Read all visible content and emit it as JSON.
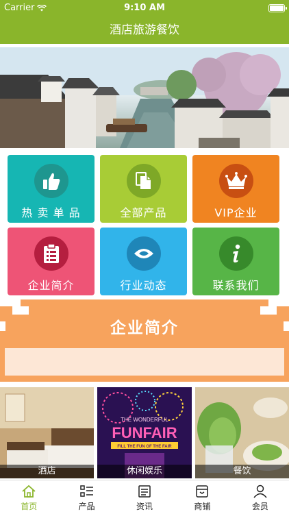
{
  "status": {
    "carrier": "Carrier",
    "time": "9:10 AM"
  },
  "nav": {
    "title": "酒店旅游餐饮"
  },
  "tiles": [
    {
      "label": "热 卖 单 品",
      "color": "#16b6b3",
      "circle": "#1e968f",
      "icon": "thumbs-up-icon"
    },
    {
      "label": "全部产品",
      "color": "#a8cc36",
      "circle": "#7ea827",
      "icon": "documents-icon"
    },
    {
      "label": "VIP企业",
      "color": "#f08421",
      "circle": "#c84f12",
      "icon": "crown-icon"
    },
    {
      "label": "企业简介",
      "color": "#ee5476",
      "circle": "#b51e3f",
      "icon": "clipboard-icon"
    },
    {
      "label": "行业动态",
      "color": "#31b4ea",
      "circle": "#1f86b8",
      "icon": "eye-icon"
    },
    {
      "label": "联系我们",
      "color": "#57b547",
      "circle": "#378a2b",
      "icon": "info-icon"
    }
  ],
  "intro": {
    "title": "企业简介"
  },
  "cards": [
    {
      "label": "酒店"
    },
    {
      "label": "休闲娱乐",
      "sign_top": "THE WONDERFUL",
      "sign_main": "FUNFAIR",
      "sign_sub": "FILL THE FUN OF THE FAIR"
    },
    {
      "label": "餐饮"
    }
  ],
  "tabs": [
    {
      "label": "首页",
      "icon": "home-icon",
      "active": true
    },
    {
      "label": "产品",
      "icon": "grid-list-icon"
    },
    {
      "label": "资讯",
      "icon": "news-icon"
    },
    {
      "label": "商铺",
      "icon": "shop-icon"
    },
    {
      "label": "会员",
      "icon": "user-icon"
    }
  ],
  "colors": {
    "brand": "#8ab52b",
    "intro": "#f7a35d",
    "intro_box": "#fde7d6"
  }
}
